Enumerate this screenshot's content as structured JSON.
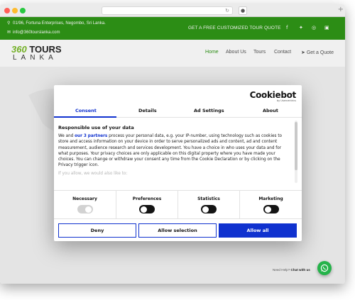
{
  "browser": {
    "dot_colors": [
      "#ff5f57",
      "#febc2e",
      "#28c840"
    ],
    "reload_icon": "reload-icon",
    "new_tab_symbol": "+"
  },
  "topbar": {
    "address": "01/96, Fortuna Enterprises, Negombo, Sri Lanka.",
    "email": "info@360tourslanka.com",
    "quote_link": "GET A FREE CUSTOMIZED TOUR QUOTE",
    "social_icons": [
      "facebook-icon",
      "twitter-icon",
      "instagram-icon",
      "linkedin-icon"
    ],
    "bg_color": "#2f9617"
  },
  "header": {
    "logo_number": "360",
    "logo_word": "TOURS",
    "logo_sub": "LANKA",
    "nav": {
      "home": "Home",
      "about": "About Us",
      "tours": "Tours",
      "contact": "Contact",
      "quote": "Get a Quote"
    },
    "active_color": "#2f9617"
  },
  "cookie": {
    "brand": "Cookiebot",
    "brand_sub": "by Usercentrics",
    "tabs": [
      "Consent",
      "Details",
      "Ad Settings",
      "About"
    ],
    "heading": "Responsible use of your data",
    "text_before": "We and ",
    "text_link": "our 3 partners",
    "text_after": " process your personal data, e.g. your IP-number, using technology such as cookies to store and access information on your device in order to serve personalized ads and content, ad and content measurement, audience research and services development. You have a choice in who uses your data and for what purposes. Your privacy choices are only applicable on this digital property where you have made your choices. You can change or withdraw your consent any time from the Cookie Declaration or by clicking on the Privacy trigger icon.",
    "faded": "If you allow, we would also like to:",
    "toggles": [
      {
        "label": "Necessary",
        "on": true
      },
      {
        "label": "Preferences",
        "on": false
      },
      {
        "label": "Statistics",
        "on": false
      },
      {
        "label": "Marketing",
        "on": false
      }
    ],
    "buttons": {
      "deny": "Deny",
      "allow_selection": "Allow selection",
      "allow_all": "Allow all"
    },
    "accent": "#1032cf"
  },
  "chat": {
    "text_plain": "Need Help? ",
    "text_bold": "Chat with us",
    "button_icon": "whatsapp-icon",
    "color": "#25b34a"
  }
}
